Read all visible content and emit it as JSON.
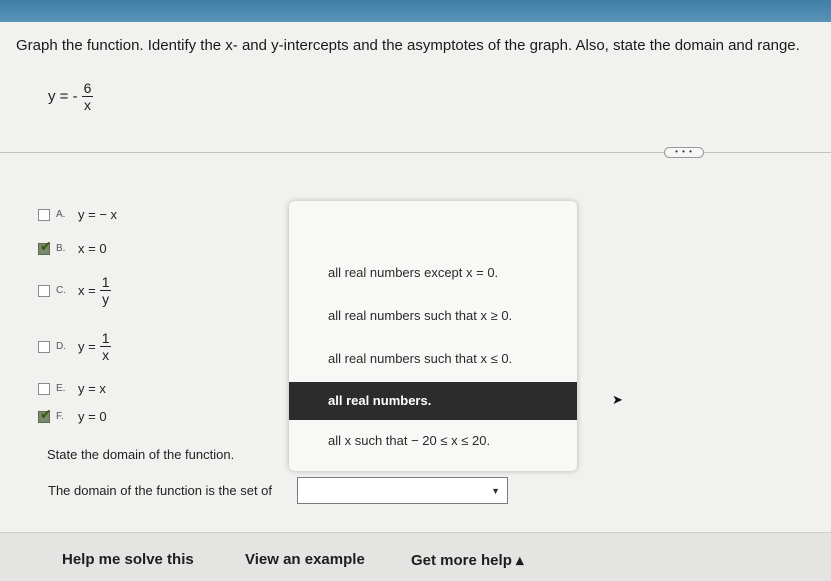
{
  "instruction": "Graph the function. Identify the x- and y-intercepts and the asymptotes of the graph. Also, state the domain and range.",
  "equation": {
    "lhs": "y = -",
    "numerator": "6",
    "denominator": "x"
  },
  "more_button": "• • •",
  "options": [
    {
      "letter": "A.",
      "expr": "y = − x",
      "checked": false
    },
    {
      "letter": "B.",
      "expr": "x = 0",
      "checked": true
    },
    {
      "letter": "C.",
      "lhs": "x =",
      "numerator": "1",
      "denominator": "y",
      "checked": false
    },
    {
      "letter": "D.",
      "lhs": "y =",
      "numerator": "1",
      "denominator": "x",
      "checked": false
    },
    {
      "letter": "E.",
      "expr": "y = x",
      "checked": false
    },
    {
      "letter": "F.",
      "expr": "y = 0",
      "checked": true
    }
  ],
  "dropdown_items": [
    "all real numbers except x = 0.",
    "all real numbers such that x ≥ 0.",
    "all real numbers such that x ≤ 0.",
    "all real numbers.",
    "all x such that  − 20 ≤ x ≤ 20."
  ],
  "dropdown_selected_index": 3,
  "domain_prompt": "State the domain of the function.",
  "answer_prefix": "The domain of the function is the set of",
  "answer_value": "",
  "footer": {
    "help_solve": "Help me solve this",
    "view_example": "View an example",
    "get_help": "Get more help ▴"
  }
}
